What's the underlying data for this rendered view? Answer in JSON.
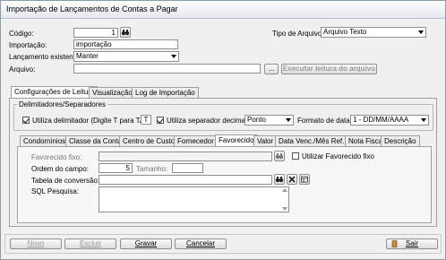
{
  "window": {
    "title": "Importação de Lançamentos de Contas a Pagar"
  },
  "header": {
    "codigo_label": "Código:",
    "codigo_value": "1",
    "tipo_label": "Tipo de Arquivo:",
    "tipo_value": "Arquivo Texto",
    "importacao_label": "Importação:",
    "importacao_value": "importação",
    "lancamento_label": "Lançamento existente:",
    "lancamento_value": "Manter",
    "arquivo_label": "Arquivo:",
    "arquivo_value": "",
    "browse_label": "...",
    "executar_label": "Executar leitura do arquivo"
  },
  "main_tabs": [
    {
      "label": "Configurações de Leitura",
      "active": true
    },
    {
      "label": "Visualização",
      "active": false
    },
    {
      "label": "Log de Importação",
      "active": false
    }
  ],
  "delimiters": {
    "group_label": "Delimitadores/Separadores",
    "utiliza_delim_label": "Utiliza delimitador (Digite T para TAB)",
    "utiliza_delim_checked": true,
    "delim_value": "T",
    "utiliza_sep_label": "Utiliza separador decimal",
    "utiliza_sep_checked": true,
    "sep_value": "Ponto",
    "formato_label": "Formato de data:",
    "formato_value": "1 - DD/MM/AAAA"
  },
  "field_tabs": [
    {
      "label": "Condomínios",
      "active": false
    },
    {
      "label": "Classe da Conta",
      "active": false
    },
    {
      "label": "Centro de Custos",
      "active": false
    },
    {
      "label": "Fornecedor",
      "active": false
    },
    {
      "label": "Favorecido",
      "active": true
    },
    {
      "label": "Valor",
      "active": false
    },
    {
      "label": "Data Venc./Mês Ref.",
      "active": false
    },
    {
      "label": "Nota Fiscal",
      "active": false
    },
    {
      "label": "Descrição",
      "active": false
    }
  ],
  "favorecido": {
    "fixo_label": "Favorecido fixo:",
    "fixo_value": "",
    "utilizar_fixo_label": "Utilizar Favorecido fixo",
    "utilizar_fixo_checked": false,
    "ordem_label": "Ordem do campo:",
    "ordem_value": "5",
    "tamanho_label": "Tamanho:",
    "tamanho_value": "",
    "tabela_label": "Tabela de conversão:",
    "tabela_value": "",
    "sql_label": "SQL Pesquisa:",
    "sql_value": ""
  },
  "footer": {
    "novo_label": "Novo",
    "excluir_label": "Excluir",
    "gravar_label": "Gravar",
    "cancelar_label": "Cancelar",
    "sair_label": "Sair"
  },
  "icons": {
    "binoculars": "binoculars-icon",
    "delete": "x-icon",
    "table": "table-icon",
    "door": "exit-door-icon"
  }
}
